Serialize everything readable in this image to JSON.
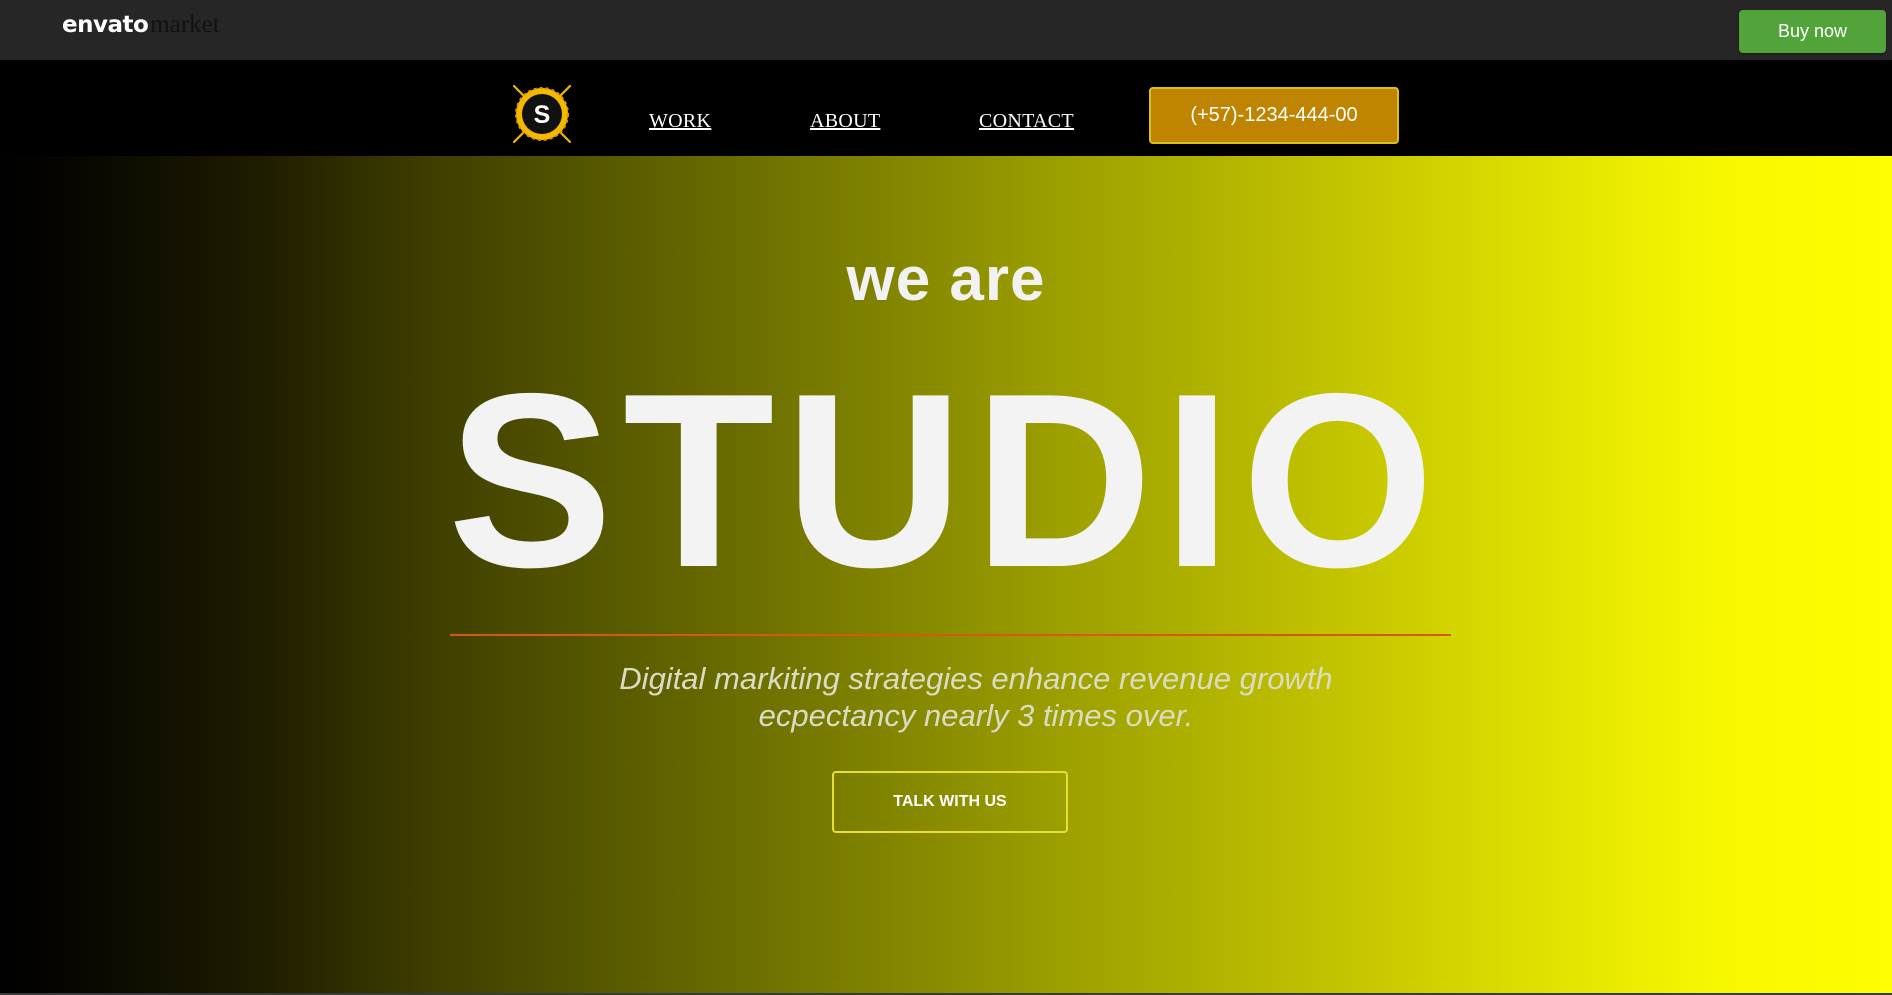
{
  "envato_bar": {
    "logo_bold": "envato",
    "logo_light": "market",
    "buy_now_label": "Buy now"
  },
  "nav": {
    "logo_letter": "S",
    "links": [
      "WORK",
      "ABOUT",
      "CONTACT"
    ],
    "phone_label": "(+57)-1234-444-00"
  },
  "hero": {
    "pre_title": "we are",
    "title": "STUDIO",
    "subtitle_line1": "Digital markiting strategies enhance revenue growth",
    "subtitle_line2": "ecpectancy nearly 3 times over.",
    "cta_label": "TALK WITH US"
  },
  "colors": {
    "envato_bar_bg": "#262626",
    "buy_now_bg": "#52a43a",
    "phone_btn_bg": "#bf8402",
    "divider": "#d45a0e",
    "cta_border": "#e8e02c",
    "logo_ring": "#f5b800"
  },
  "icons": {
    "site_logo": "sun-badge-icon"
  }
}
